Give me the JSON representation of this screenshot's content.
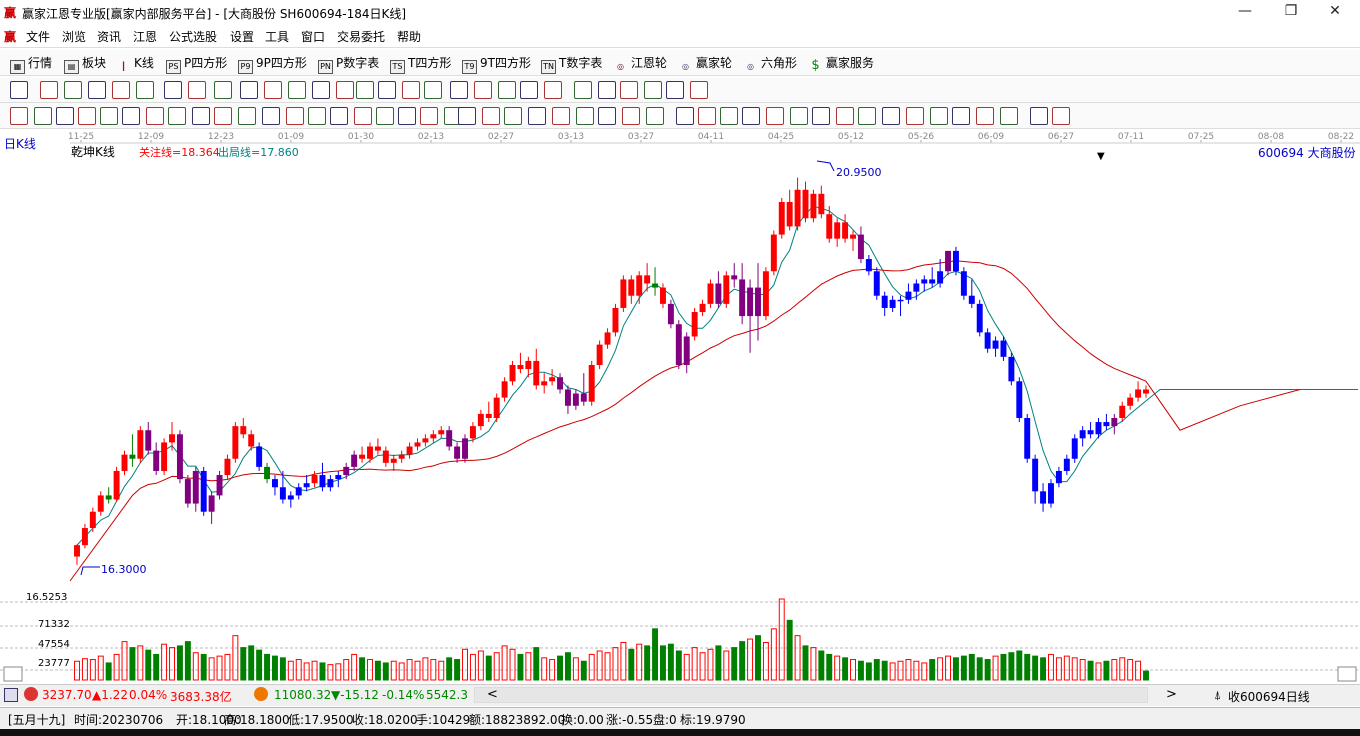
{
  "window": {
    "app_icon": "赢",
    "title": "赢家江恩专业版[赢家内部服务平台] - [大商股份  SH600694-184日K线]",
    "btn_min": "—",
    "btn_max": "❐",
    "btn_close": "✕"
  },
  "menu": {
    "app_icon": "赢",
    "items": [
      "文件",
      "浏览",
      "资讯",
      "江恩",
      "公式选股",
      "设置",
      "工具",
      "窗口",
      "交易委托",
      "帮助"
    ],
    "mdi_min": "_",
    "mdi_restore": "❐",
    "mdi_close": "x"
  },
  "toolbar1": {
    "items": [
      {
        "label": "行情",
        "icon": "grid-icon"
      },
      {
        "label": "板块",
        "icon": "sector-icon"
      },
      {
        "label": "K线",
        "icon": "candle-icon"
      },
      {
        "label": "P四方形",
        "icon": "p-square-icon",
        "tag": "PS"
      },
      {
        "label": "9P四方形",
        "icon": "9p-square-icon",
        "tag": "P9"
      },
      {
        "label": "P数字表",
        "icon": "p-number-icon",
        "tag": "PN"
      },
      {
        "label": "T四方形",
        "icon": "t-square-icon",
        "tag": "TS"
      },
      {
        "label": "9T四方形",
        "icon": "9t-square-icon",
        "tag": "T9"
      },
      {
        "label": "T数字表",
        "icon": "t-number-icon",
        "tag": "TN"
      },
      {
        "label": "江恩轮",
        "icon": "gann-wheel-icon",
        "tag": "◎"
      },
      {
        "label": "赢家轮",
        "icon": "winner-wheel-icon",
        "tag": "◎"
      },
      {
        "label": "六角形",
        "icon": "hexagon-icon",
        "tag": "◎"
      },
      {
        "label": "赢家服务",
        "icon": "dollar-icon",
        "tag": "$"
      }
    ]
  },
  "chart_header": {
    "period_label": "日K线",
    "indicator_name": "乾坤K线",
    "focus_line": "关注线=18.364",
    "exit_line": "出局线=17.860",
    "stock": "600694  大商股份",
    "high_label": "20.9500",
    "low_label": "16.3000",
    "price_axis_label": "16.5253",
    "vol_labels": [
      "71332",
      "47554",
      "23777"
    ],
    "scroll_mark": "▼"
  },
  "date_axis": [
    "11-25",
    "12-09",
    "12-23",
    "01-09",
    "01-30",
    "02-13",
    "02-27",
    "03-13",
    "03-27",
    "04-11",
    "04-25",
    "05-12",
    "05-26",
    "06-09",
    "06-27",
    "07-11",
    "07-25",
    "08-08",
    "08-22"
  ],
  "chart_data": {
    "type": "candlestick",
    "title": "日K线",
    "series_names": [
      "乾坤K线"
    ],
    "price_range": [
      16.0,
      21.3
    ],
    "volume_max": 95000,
    "candles": [
      [
        16.3,
        16.45,
        16.2,
        16.44,
        "r",
        22000
      ],
      [
        16.44,
        16.7,
        16.4,
        16.65,
        "r",
        25000
      ],
      [
        16.65,
        16.9,
        16.6,
        16.85,
        "r",
        24000
      ],
      [
        16.85,
        17.1,
        16.8,
        17.05,
        "r",
        28000
      ],
      [
        17.05,
        17.15,
        16.95,
        17.0,
        "g",
        20000
      ],
      [
        17.0,
        17.4,
        16.98,
        17.35,
        "r",
        30000
      ],
      [
        17.35,
        17.6,
        17.3,
        17.55,
        "r",
        45000
      ],
      [
        17.55,
        17.8,
        17.4,
        17.5,
        "g",
        38000
      ],
      [
        17.5,
        17.9,
        17.45,
        17.85,
        "r",
        40000
      ],
      [
        17.85,
        17.95,
        17.55,
        17.6,
        "p",
        35000
      ],
      [
        17.6,
        17.7,
        17.3,
        17.35,
        "p",
        30000
      ],
      [
        17.35,
        17.75,
        17.3,
        17.7,
        "r",
        42000
      ],
      [
        17.7,
        17.95,
        17.6,
        17.8,
        "r",
        38000
      ],
      [
        17.8,
        17.85,
        17.2,
        17.25,
        "p",
        40000
      ],
      [
        17.25,
        17.3,
        16.9,
        16.95,
        "p",
        45000
      ],
      [
        16.95,
        17.4,
        16.85,
        17.35,
        "p",
        32000
      ],
      [
        17.35,
        17.4,
        16.8,
        16.85,
        "b",
        30000
      ],
      [
        16.85,
        17.1,
        16.7,
        17.05,
        "p",
        26000
      ],
      [
        17.05,
        17.35,
        17.0,
        17.3,
        "p",
        28000
      ],
      [
        17.3,
        17.55,
        17.25,
        17.5,
        "r",
        30000
      ],
      [
        17.5,
        17.95,
        17.45,
        17.9,
        "r",
        52000
      ],
      [
        17.9,
        18.0,
        17.75,
        17.8,
        "r",
        38000
      ],
      [
        17.8,
        17.85,
        17.6,
        17.65,
        "r",
        40000
      ],
      [
        17.65,
        17.7,
        17.35,
        17.4,
        "b",
        35000
      ],
      [
        17.4,
        17.45,
        17.2,
        17.25,
        "g",
        30000
      ],
      [
        17.25,
        17.3,
        17.05,
        17.15,
        "b",
        28000
      ],
      [
        17.15,
        17.35,
        16.95,
        17.0,
        "b",
        26000
      ],
      [
        17.0,
        17.1,
        16.9,
        17.05,
        "b",
        22000
      ],
      [
        17.05,
        17.2,
        17.0,
        17.15,
        "b",
        24000
      ],
      [
        17.15,
        17.3,
        17.1,
        17.2,
        "b",
        20000
      ],
      [
        17.2,
        17.35,
        17.15,
        17.3,
        "r",
        22000
      ],
      [
        17.3,
        17.45,
        17.1,
        17.15,
        "b",
        20000
      ],
      [
        17.15,
        17.3,
        17.1,
        17.25,
        "b",
        18000
      ],
      [
        17.25,
        17.35,
        17.15,
        17.3,
        "b",
        19000
      ],
      [
        17.3,
        17.45,
        17.25,
        17.4,
        "p",
        24000
      ],
      [
        17.4,
        17.6,
        17.35,
        17.55,
        "p",
        30000
      ],
      [
        17.55,
        17.65,
        17.45,
        17.5,
        "r",
        26000
      ],
      [
        17.5,
        17.7,
        17.45,
        17.65,
        "r",
        24000
      ],
      [
        17.65,
        17.75,
        17.55,
        17.6,
        "r",
        22000
      ],
      [
        17.6,
        17.65,
        17.4,
        17.45,
        "r",
        20000
      ],
      [
        17.45,
        17.55,
        17.35,
        17.5,
        "r",
        22000
      ],
      [
        17.5,
        17.6,
        17.45,
        17.55,
        "r",
        20000
      ],
      [
        17.55,
        17.7,
        17.5,
        17.65,
        "r",
        24000
      ],
      [
        17.65,
        17.75,
        17.6,
        17.7,
        "r",
        22000
      ],
      [
        17.7,
        17.8,
        17.65,
        17.75,
        "r",
        26000
      ],
      [
        17.75,
        17.85,
        17.7,
        17.8,
        "r",
        24000
      ],
      [
        17.8,
        17.9,
        17.75,
        17.85,
        "r",
        22000
      ],
      [
        17.85,
        17.9,
        17.6,
        17.65,
        "p",
        26000
      ],
      [
        17.65,
        17.7,
        17.45,
        17.5,
        "p",
        24000
      ],
      [
        17.5,
        17.8,
        17.45,
        17.75,
        "p",
        36000
      ],
      [
        17.75,
        17.95,
        17.7,
        17.9,
        "r",
        30000
      ],
      [
        17.9,
        18.1,
        17.85,
        18.05,
        "r",
        34000
      ],
      [
        18.05,
        18.2,
        17.95,
        18.0,
        "r",
        28000
      ],
      [
        18.0,
        18.3,
        17.95,
        18.25,
        "r",
        32000
      ],
      [
        18.25,
        18.5,
        18.2,
        18.45,
        "r",
        40000
      ],
      [
        18.45,
        18.7,
        18.4,
        18.65,
        "r",
        36000
      ],
      [
        18.65,
        18.8,
        18.55,
        18.6,
        "r",
        30000
      ],
      [
        18.6,
        18.75,
        18.5,
        18.7,
        "r",
        32000
      ],
      [
        18.7,
        18.85,
        18.35,
        18.4,
        "r",
        38000
      ],
      [
        18.4,
        18.55,
        18.3,
        18.45,
        "r",
        26000
      ],
      [
        18.45,
        18.6,
        18.4,
        18.5,
        "r",
        24000
      ],
      [
        18.5,
        18.55,
        18.3,
        18.35,
        "p",
        28000
      ],
      [
        18.35,
        18.4,
        18.05,
        18.15,
        "p",
        32000
      ],
      [
        18.15,
        18.35,
        18.1,
        18.3,
        "p",
        26000
      ],
      [
        18.3,
        18.55,
        18.15,
        18.2,
        "p",
        22000
      ],
      [
        18.2,
        18.7,
        18.15,
        18.65,
        "r",
        30000
      ],
      [
        18.65,
        18.95,
        18.6,
        18.9,
        "r",
        34000
      ],
      [
        18.9,
        19.1,
        18.85,
        19.05,
        "r",
        32000
      ],
      [
        19.05,
        19.4,
        19.0,
        19.35,
        "r",
        38000
      ],
      [
        19.35,
        19.75,
        19.3,
        19.7,
        "r",
        44000
      ],
      [
        19.7,
        19.75,
        19.4,
        19.5,
        "r",
        36000
      ],
      [
        19.5,
        19.8,
        19.4,
        19.75,
        "r",
        42000
      ],
      [
        19.75,
        19.9,
        19.55,
        19.65,
        "r",
        40000
      ],
      [
        19.65,
        19.85,
        19.5,
        19.6,
        "g",
        60000
      ],
      [
        19.6,
        19.65,
        19.35,
        19.4,
        "r",
        40000
      ],
      [
        19.4,
        19.45,
        19.1,
        19.15,
        "p",
        42000
      ],
      [
        19.15,
        19.2,
        18.6,
        18.65,
        "p",
        34000
      ],
      [
        18.65,
        19.05,
        18.55,
        19.0,
        "p",
        30000
      ],
      [
        19.0,
        19.35,
        18.95,
        19.3,
        "r",
        38000
      ],
      [
        19.3,
        19.45,
        19.25,
        19.4,
        "r",
        32000
      ],
      [
        19.4,
        19.7,
        19.35,
        19.65,
        "r",
        36000
      ],
      [
        19.65,
        19.8,
        19.35,
        19.4,
        "p",
        40000
      ],
      [
        19.4,
        19.8,
        19.35,
        19.75,
        "r",
        34000
      ],
      [
        19.75,
        19.9,
        19.6,
        19.7,
        "p",
        38000
      ],
      [
        19.7,
        19.9,
        19.15,
        19.25,
        "p",
        45000
      ],
      [
        19.25,
        19.7,
        18.8,
        19.6,
        "p",
        48000
      ],
      [
        19.6,
        19.9,
        18.95,
        19.25,
        "p",
        52000
      ],
      [
        19.25,
        19.85,
        19.2,
        19.8,
        "r",
        44000
      ],
      [
        19.8,
        20.3,
        19.75,
        20.25,
        "r",
        60000
      ],
      [
        20.25,
        20.7,
        20.2,
        20.65,
        "r",
        95000
      ],
      [
        20.65,
        20.8,
        20.3,
        20.35,
        "r",
        70000
      ],
      [
        20.35,
        20.95,
        20.3,
        20.8,
        "r",
        52000
      ],
      [
        20.8,
        20.9,
        20.4,
        20.45,
        "r",
        40000
      ],
      [
        20.45,
        20.8,
        20.4,
        20.75,
        "r",
        38000
      ],
      [
        20.75,
        20.85,
        20.45,
        20.5,
        "r",
        34000
      ],
      [
        20.5,
        20.6,
        20.15,
        20.2,
        "r",
        30000
      ],
      [
        20.2,
        20.45,
        20.1,
        20.4,
        "r",
        28000
      ],
      [
        20.4,
        20.5,
        20.15,
        20.2,
        "r",
        26000
      ],
      [
        20.2,
        20.3,
        20.05,
        20.25,
        "r",
        24000
      ],
      [
        20.25,
        20.35,
        19.9,
        19.95,
        "p",
        22000
      ],
      [
        19.95,
        20.0,
        19.75,
        19.8,
        "b",
        20000
      ],
      [
        19.8,
        19.85,
        19.45,
        19.5,
        "b",
        24000
      ],
      [
        19.5,
        19.55,
        19.25,
        19.35,
        "b",
        22000
      ],
      [
        19.35,
        19.5,
        19.3,
        19.45,
        "b",
        20000
      ],
      [
        19.45,
        19.5,
        19.25,
        19.45,
        "b",
        22000
      ],
      [
        19.45,
        19.65,
        19.4,
        19.55,
        "b",
        24000
      ],
      [
        19.55,
        19.7,
        19.45,
        19.65,
        "b",
        22000
      ],
      [
        19.65,
        19.75,
        19.55,
        19.7,
        "b",
        20000
      ],
      [
        19.7,
        19.85,
        19.6,
        19.65,
        "b",
        24000
      ],
      [
        19.65,
        19.95,
        19.6,
        19.8,
        "b",
        26000
      ],
      [
        19.8,
        20.05,
        19.75,
        20.05,
        "p",
        28000
      ],
      [
        20.05,
        20.1,
        19.75,
        19.8,
        "b",
        26000
      ],
      [
        19.8,
        19.85,
        19.45,
        19.5,
        "b",
        28000
      ],
      [
        19.5,
        19.7,
        19.35,
        19.4,
        "b",
        30000
      ],
      [
        19.4,
        19.45,
        19.0,
        19.05,
        "b",
        26000
      ],
      [
        19.05,
        19.1,
        18.8,
        18.85,
        "b",
        24000
      ],
      [
        18.85,
        19.0,
        18.75,
        18.95,
        "b",
        28000
      ],
      [
        18.95,
        19.0,
        18.7,
        18.75,
        "b",
        30000
      ],
      [
        18.75,
        18.8,
        18.4,
        18.45,
        "b",
        32000
      ],
      [
        18.45,
        18.5,
        17.95,
        18.0,
        "b",
        34000
      ],
      [
        18.0,
        18.05,
        17.45,
        17.5,
        "b",
        30000
      ],
      [
        17.5,
        17.55,
        16.95,
        17.1,
        "b",
        28000
      ],
      [
        17.1,
        17.2,
        16.85,
        16.95,
        "b",
        26000
      ],
      [
        16.95,
        17.25,
        16.9,
        17.2,
        "b",
        30000
      ],
      [
        17.2,
        17.4,
        17.15,
        17.35,
        "b",
        26000
      ],
      [
        17.35,
        17.55,
        17.3,
        17.5,
        "b",
        28000
      ],
      [
        17.5,
        17.8,
        17.45,
        17.75,
        "b",
        26000
      ],
      [
        17.75,
        17.9,
        17.65,
        17.85,
        "b",
        24000
      ],
      [
        17.85,
        17.95,
        17.75,
        17.8,
        "b",
        22000
      ],
      [
        17.8,
        18.0,
        17.75,
        17.95,
        "b",
        20000
      ],
      [
        17.95,
        18.05,
        17.85,
        17.9,
        "b",
        22000
      ],
      [
        17.9,
        18.05,
        17.8,
        18.0,
        "p",
        24000
      ],
      [
        18.0,
        18.2,
        17.95,
        18.15,
        "r",
        26000
      ],
      [
        18.15,
        18.3,
        18.1,
        18.25,
        "r",
        24000
      ],
      [
        18.25,
        18.45,
        18.2,
        18.35,
        "r",
        22000
      ],
      [
        18.35,
        18.4,
        18.25,
        18.3,
        "r",
        10429
      ]
    ],
    "ma_line_color": "#008080",
    "long_line_color": "#cc0000"
  },
  "status_row": {
    "idx1_value": "3237.70",
    "idx1_change": "▲1.22",
    "idx1_pct": "0.04%",
    "idx1_amount": "3683.38亿",
    "idx2_value": "11080.32",
    "idx2_change": "▼-15.12",
    "idx2_pct": "-0.14%",
    "idx2_amount": "5542.3",
    "scroll_left": "<",
    "scroll_right": ">",
    "right_label": "收600694日线"
  },
  "info_bar": {
    "lunar": "[五月十九]",
    "time": "时间:20230706",
    "open": "开:18.1000",
    "high": "高:18.1800",
    "low": "低:17.9500",
    "close": "收:18.0200",
    "hand": "手:10429",
    "amount": "额:18823892.00",
    "turnover": "换:0.00",
    "change": "涨:-0.55",
    "pan": "盘:0",
    "mark": "标:19.9790"
  },
  "colors": {
    "up": "#ff0000",
    "down": "#0000ff",
    "purple": "#800080",
    "vol_up": "#ff0000",
    "vol_down": "#008000"
  }
}
